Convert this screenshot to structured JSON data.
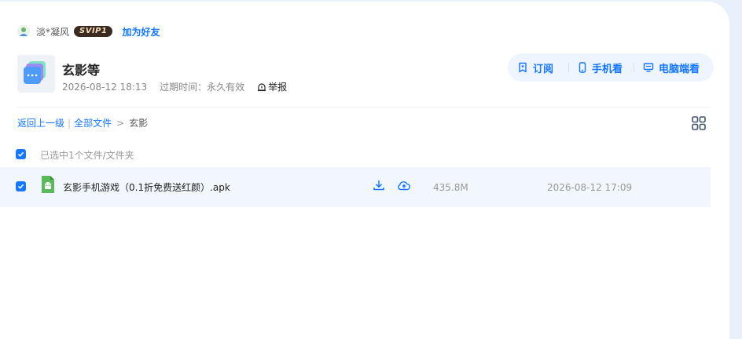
{
  "user": {
    "name": "淡*凝风",
    "badge": "SVIP1",
    "add_friend": "加为好友"
  },
  "share": {
    "title": "玄影等",
    "created": "2026-08-12 18:13",
    "expire": "过期时间：永久有效",
    "report": "举报"
  },
  "actions": {
    "subscribe": "订阅",
    "phone": "手机看",
    "pc": "电脑端看"
  },
  "breadcrumb": {
    "back": "返回上一级",
    "all": "全部文件",
    "current": "玄影"
  },
  "selection": {
    "summary": "已选中1个文件/文件夹"
  },
  "files": [
    {
      "name": "玄影手机游戏（0.1折免费送红颜）.apk",
      "size": "435.8M",
      "date": "2026-08-12 17:09"
    }
  ],
  "colors": {
    "accent": "#1677ff",
    "row_highlight": "#f2f7fd",
    "badge_bg": "#3a2a22"
  }
}
